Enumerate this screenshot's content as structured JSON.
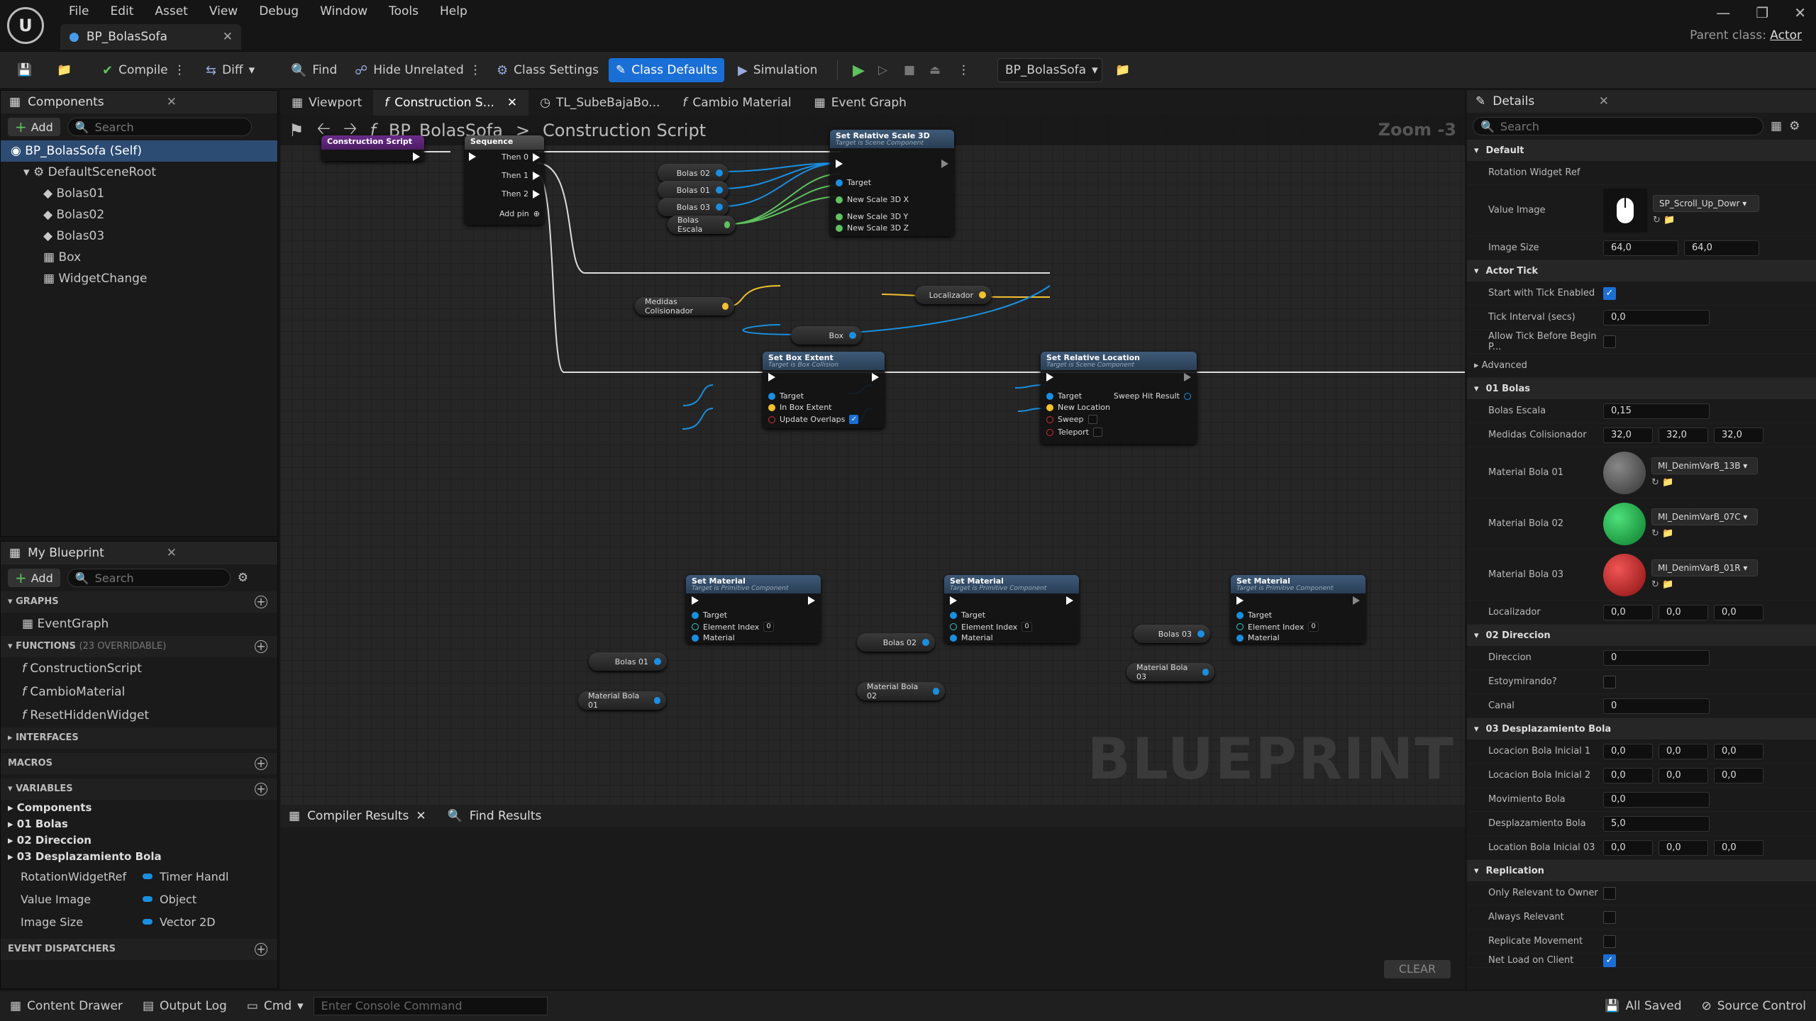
{
  "app": {
    "menu": [
      "File",
      "Edit",
      "Asset",
      "View",
      "Debug",
      "Window",
      "Tools",
      "Help"
    ],
    "doc_tab": "BP_BolasSofa",
    "parent_label": "Parent class:",
    "parent_value": "Actor"
  },
  "toolbar": {
    "compile": "Compile",
    "diff": "Diff",
    "find": "Find",
    "hide_unrelated": "Hide Unrelated",
    "class_settings": "Class Settings",
    "class_defaults": "Class Defaults",
    "simulation": "Simulation",
    "debug_object": "BP_BolasSofa"
  },
  "components": {
    "title": "Components",
    "add": "Add",
    "search_placeholder": "Search",
    "items": [
      "BP_BolasSofa (Self)",
      "DefaultSceneRoot",
      "Bolas01",
      "Bolas02",
      "Bolas03",
      "Box",
      "WidgetChange"
    ]
  },
  "my_blueprint": {
    "title": "My Blueprint",
    "add": "Add",
    "search_placeholder": "Search",
    "graphs_label": "GRAPHS",
    "graphs": [
      "EventGraph"
    ],
    "functions_label": "FUNCTIONS",
    "functions_count": "(23 OVERRIDABLE)",
    "functions": [
      "ConstructionScript",
      "CambioMaterial",
      "ResetHiddenWidget"
    ],
    "interfaces_label": "INTERFACES",
    "macros_label": "MACROS",
    "variables_label": "VARIABLES",
    "var_groups": [
      "Components",
      "01 Bolas",
      "02 Direccion",
      "03 Desplazamiento Bola"
    ],
    "vars": [
      {
        "name": "RotationWidgetRef",
        "type": "Timer Handl"
      },
      {
        "name": "Value Image",
        "type": "Object"
      },
      {
        "name": "Image Size",
        "type": "Vector 2D"
      }
    ],
    "dispatchers_label": "EVENT DISPATCHERS"
  },
  "graph_tabs": [
    "Viewport",
    "Construction S...",
    "TL_SubeBajaBo...",
    "Cambio Material",
    "Event Graph"
  ],
  "graph": {
    "crumb_bp": "BP_BolasSofa",
    "crumb_fn": "Construction Script",
    "zoom": "Zoom -3",
    "watermark": "BLUEPRINT",
    "nodes": {
      "cs": "Construction Script",
      "seq": "Sequence",
      "then0": "Then 0",
      "then1": "Then 1",
      "then2": "Then 2",
      "addpin": "Add pin",
      "scale": "Set Relative Scale 3D",
      "scale_sub": "Target is Scene Component",
      "target": "Target",
      "nsx": "New Scale 3D X",
      "nsy": "New Scale 3D Y",
      "nsz": "New Scale 3D Z",
      "box": "Set Box Extent",
      "box_sub": "Target is Box Collision",
      "inbox": "In Box Extent",
      "overlaps": "Update Overlaps",
      "loc": "Set Relative Location",
      "loc_sub": "Target is Scene Component",
      "newloc": "New Location",
      "sweep": "Sweep",
      "teleport": "Teleport",
      "sweephit": "Sweep Hit Result",
      "mat": "Set Material",
      "mat_sub": "Target is Primitive Component",
      "elem": "Element Index",
      "elem_val": "0",
      "material": "Material"
    },
    "vars": {
      "b02": "Bolas 02",
      "b01": "Bolas 01",
      "b03": "Bolas 03",
      "escala": "Bolas Escala",
      "medidas": "Medidas Colisionador",
      "localizador": "Localizador",
      "box": "Box",
      "mb01": "Material Bola 01",
      "mb02": "Material Bola 02",
      "mb03": "Material Bola 03"
    }
  },
  "bottom": {
    "tab1": "Compiler Results",
    "tab2": "Find Results",
    "clear": "CLEAR"
  },
  "details": {
    "title": "Details",
    "search_placeholder": "Search",
    "default": "Default",
    "rot_ref": "Rotation Widget Ref",
    "value_image": "Value Image",
    "value_image_asset": "SP_Scroll_Up_Dowr",
    "image_size": "Image Size",
    "img_x": "64,0",
    "img_y": "64,0",
    "actor_tick": "Actor Tick",
    "tick_enabled": "Start with Tick Enabled",
    "tick_interval": "Tick Interval (secs)",
    "tick_interval_v": "0,0",
    "allow_tick": "Allow Tick Before Begin P...",
    "advanced": "Advanced",
    "bolas": "01 Bolas",
    "escala": "Bolas Escala",
    "escala_v": "0,15",
    "medidas": "Medidas Colisionador",
    "m1": "32,0",
    "m2": "32,0",
    "m3": "32,0",
    "mb01": "Material Bola 01",
    "mb01_v": "MI_DenimVarB_13B",
    "mb02": "Material Bola 02",
    "mb02_v": "MI_DenimVarB_07C",
    "mb03": "Material Bola 03",
    "mb03_v": "MI_DenimVarB_01R",
    "localizador": "Localizador",
    "l1": "0,0",
    "l2": "0,0",
    "l3": "0,0",
    "direccion_s": "02 Direccion",
    "direccion": "Direccion",
    "direccion_v": "0",
    "estoy": "Estoymirando?",
    "canal": "Canal",
    "canal_v": "0",
    "desp_s": "03 Desplazamiento Bola",
    "lb1": "Locacion Bola Inicial 1",
    "lb1a": "0,0",
    "lb1b": "0,0",
    "lb1c": "0,0",
    "lb2": "Locacion Bola Inicial 2",
    "lb2a": "0,0",
    "lb2b": "0,0",
    "lb2c": "0,0",
    "movimiento": "Movimiento Bola",
    "movimiento_v": "0,0",
    "desplaz": "Desplazamiento Bola",
    "desplaz_v": "5,0",
    "lb3": "Location Bola Inicial 03",
    "lb3a": "0,0",
    "lb3b": "0,0",
    "lb3c": "0,0",
    "replication": "Replication",
    "rel_owner": "Only Relevant to Owner",
    "always_rel": "Always Relevant",
    "rep_move": "Replicate Movement",
    "net_load": "Net Load on Client"
  },
  "status": {
    "content_drawer": "Content Drawer",
    "output_log": "Output Log",
    "cmd": "Cmd",
    "console_placeholder": "Enter Console Command",
    "saved": "All Saved",
    "source_control": "Source Control"
  },
  "colors": {
    "accent": "#1a6fd6",
    "exec": "#ffffff",
    "object_pin": "#1a8fe0",
    "float_pin": "#5ec25e",
    "vector_pin": "#f2c12e"
  }
}
